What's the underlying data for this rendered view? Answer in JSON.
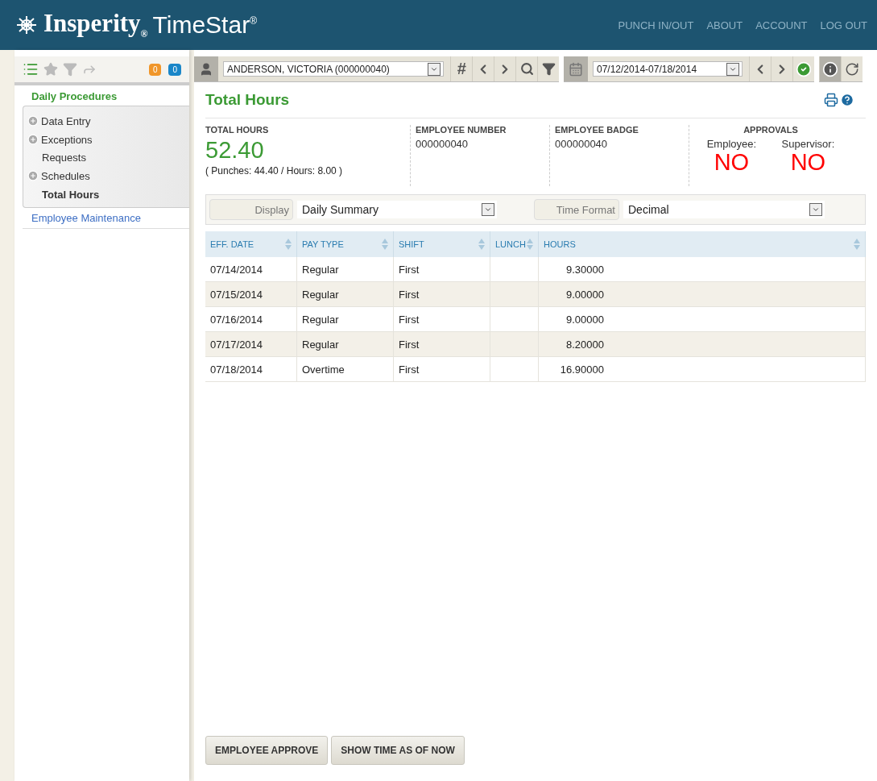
{
  "header": {
    "logo_brand": "Insperity$_{®}$",
    "logo_product": "TimeStar$^{®}$",
    "nav": [
      "PUNCH IN/OUT",
      "ABOUT",
      "ACCOUNT",
      "LOG OUT"
    ]
  },
  "sidebar": {
    "badges": [
      {
        "count": "0",
        "color": "#f0962a"
      },
      {
        "count": "0",
        "color": "#1a86c8"
      }
    ],
    "sections": [
      {
        "kind": "group",
        "title": "Daily Procedures",
        "items": [
          {
            "label": "Data Entry",
            "expandable": true,
            "selected": false
          },
          {
            "label": "Exceptions",
            "expandable": true,
            "selected": false
          },
          {
            "label": "Requests",
            "expandable": false,
            "selected": false
          },
          {
            "label": "Schedules",
            "expandable": true,
            "selected": false
          },
          {
            "label": "Total Hours",
            "expandable": false,
            "selected": true
          }
        ]
      },
      {
        "kind": "link",
        "title": "Employee Maintenance"
      }
    ]
  },
  "toolbar": {
    "employee": "ANDERSON, VICTORIA (000000040)",
    "number_button": "#",
    "date_range": "07/12/2014-07/18/2014"
  },
  "page_title": "Total Hours",
  "summary": {
    "total_label": "TOTAL HOURS",
    "total_value": "52.40",
    "total_detail": "( Punches: 44.40 / Hours: 8.00 )",
    "fields": [
      {
        "label": "EMPLOYEE NUMBER",
        "value": "000000040"
      },
      {
        "label": "EMPLOYEE BADGE",
        "value": "000000040"
      }
    ],
    "approvals_title": "APPROVALS",
    "approvals": [
      {
        "label": "Employee:",
        "value": "NO"
      },
      {
        "label": "Supervisor:",
        "value": "NO"
      }
    ]
  },
  "filters": [
    {
      "label": "Display",
      "value": "Daily Summary"
    },
    {
      "label": "Time Format",
      "value": "Decimal"
    }
  ],
  "table": {
    "columns": [
      "EFF. DATE",
      "PAY TYPE",
      "SHIFT",
      "LUNCH",
      "HOURS"
    ],
    "rows": [
      [
        "07/14/2014",
        "Regular",
        "First",
        "",
        "9.30000"
      ],
      [
        "07/15/2014",
        "Regular",
        "First",
        "",
        "9.00000"
      ],
      [
        "07/16/2014",
        "Regular",
        "First",
        "",
        "9.00000"
      ],
      [
        "07/17/2014",
        "Regular",
        "First",
        "",
        "8.20000"
      ],
      [
        "07/18/2014",
        "Overtime",
        "First",
        "",
        "16.90000"
      ]
    ]
  },
  "buttons": [
    "EMPLOYEE APPROVE",
    "SHOW TIME AS OF NOW"
  ]
}
